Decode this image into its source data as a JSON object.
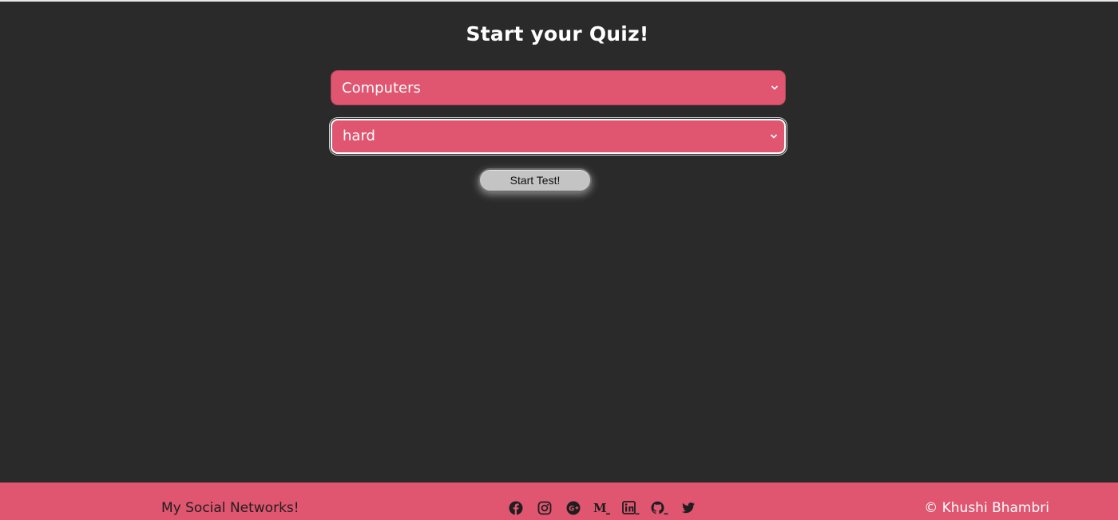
{
  "page": {
    "title": "Start your Quiz!"
  },
  "selects": {
    "category": {
      "value": "Computers"
    },
    "difficulty": {
      "value": "hard"
    }
  },
  "start_button": {
    "label": "Start Test!"
  },
  "footer": {
    "networks_label": "My Social Networks!",
    "social_icons": [
      "facebook-icon",
      "instagram-icon",
      "google-plus-icon",
      "medium-icon",
      "linkedin-icon",
      "github-icon",
      "twitter-icon"
    ],
    "copyright": "© Khushi Bhambri"
  },
  "colors": {
    "background": "#2a2a2a",
    "accent": "#e05570",
    "button": "#c4c4c4"
  }
}
